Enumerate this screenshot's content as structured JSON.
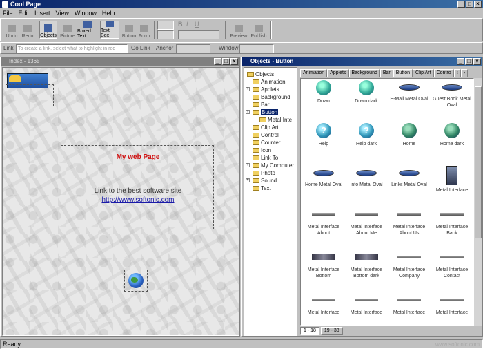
{
  "app": {
    "title": "Cool Page"
  },
  "menu": [
    "File",
    "Edit",
    "Insert",
    "View",
    "Window",
    "Help"
  ],
  "toolbar": {
    "buttons": [
      "Undo",
      "Redo",
      "Objects",
      "Picture",
      "Boxed Text",
      "Text Box",
      "Button",
      "Form"
    ],
    "style_buttons": [
      "B",
      "I",
      "U"
    ],
    "right_buttons": [
      "Preview",
      "Publish"
    ]
  },
  "linkbar": {
    "link_label": "Link",
    "link_placeholder": "To create a link, select what to highlight in red",
    "button_label": "Go Link",
    "anchor_label": "Anchor",
    "window_label": "Window"
  },
  "editor": {
    "window_title": "Index - 1365",
    "page_title": "My web Page",
    "body_text": "Link to the best software site",
    "url": "http://www.softonic.com"
  },
  "objects": {
    "window_title": "Objects - Button",
    "tree": [
      {
        "label": "Objects",
        "expandable": false,
        "level": 0
      },
      {
        "label": "Animation",
        "expandable": false,
        "level": 1
      },
      {
        "label": "Applets",
        "expandable": true,
        "level": 1
      },
      {
        "label": "Background",
        "expandable": false,
        "level": 1
      },
      {
        "label": "Bar",
        "expandable": false,
        "level": 1
      },
      {
        "label": "Button",
        "expandable": true,
        "level": 1,
        "selected": true
      },
      {
        "label": "Metal Inte",
        "expandable": false,
        "level": 2
      },
      {
        "label": "Clip Art",
        "expandable": false,
        "level": 1
      },
      {
        "label": "Control",
        "expandable": false,
        "level": 1
      },
      {
        "label": "Counter",
        "expandable": false,
        "level": 1
      },
      {
        "label": "Icon",
        "expandable": false,
        "level": 1
      },
      {
        "label": "Link To",
        "expandable": false,
        "level": 1
      },
      {
        "label": "My Computer",
        "expandable": true,
        "level": 1
      },
      {
        "label": "Photo",
        "expandable": false,
        "level": 1
      },
      {
        "label": "Sound",
        "expandable": true,
        "level": 1
      },
      {
        "label": "Text",
        "expandable": false,
        "level": 1
      }
    ],
    "tabs": [
      "Animation",
      "Applets",
      "Background",
      "Bar",
      "Button",
      "Clip Art",
      "Contro"
    ],
    "active_tab": "Button",
    "items": [
      {
        "label": "Down",
        "icon": "down"
      },
      {
        "label": "Down dark",
        "icon": "down"
      },
      {
        "label": "E-Mail Metal Oval",
        "icon": "oval"
      },
      {
        "label": "Guest Book Metal Oval",
        "icon": "oval"
      },
      {
        "label": "Help",
        "icon": "help"
      },
      {
        "label": "Help dark",
        "icon": "help"
      },
      {
        "label": "Home",
        "icon": "home"
      },
      {
        "label": "Home dark",
        "icon": "home"
      },
      {
        "label": "Home Metal Oval",
        "icon": "oval"
      },
      {
        "label": "Info Metal Oval",
        "icon": "oval"
      },
      {
        "label": "Links Metal Oval",
        "icon": "oval"
      },
      {
        "label": "Metal Interface",
        "icon": "panel"
      },
      {
        "label": "Metal Interface About",
        "icon": "bar"
      },
      {
        "label": "Metal Interface About Me",
        "icon": "bar"
      },
      {
        "label": "Metal Interface About Us",
        "icon": "bar"
      },
      {
        "label": "Metal Interface Back",
        "icon": "bar"
      },
      {
        "label": "Metal Interface Bottom",
        "icon": "bar2"
      },
      {
        "label": "Metal Interface Bottom dark",
        "icon": "bar2"
      },
      {
        "label": "Metal Interface Company",
        "icon": "bar"
      },
      {
        "label": "Metal Interface Contact",
        "icon": "bar"
      },
      {
        "label": "Metal Interface",
        "icon": "bar"
      },
      {
        "label": "Metal Interface",
        "icon": "bar"
      },
      {
        "label": "Metal Interface",
        "icon": "bar"
      },
      {
        "label": "Metal Interface",
        "icon": "bar"
      }
    ],
    "pager": [
      "1 - 18",
      "19 - 38"
    ]
  },
  "status": {
    "text": "Ready",
    "watermark": "www.softonic.com"
  }
}
